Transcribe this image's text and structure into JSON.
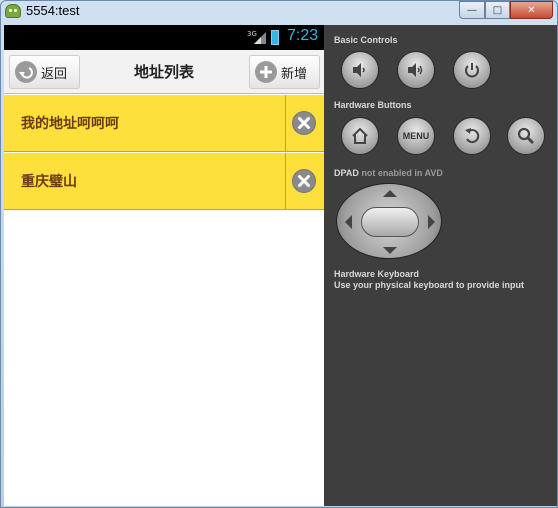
{
  "window": {
    "title": "5554:test",
    "buttons": {
      "minimize": "—",
      "maximize": "□",
      "close": "✕"
    }
  },
  "statusbar": {
    "network": "3G",
    "time": "7:23",
    "accent_color": "#33b5e5"
  },
  "header": {
    "back_label": "返回",
    "title": "地址列表",
    "add_label": "新增"
  },
  "addresses": [
    {
      "label": "我的地址呵呵呵"
    },
    {
      "label": "重庆璧山"
    }
  ],
  "list_color": "#fee03c",
  "controls": {
    "basic_controls_label": "Basic Controls",
    "hardware_buttons_label": "Hardware Buttons",
    "menu_label": "MENU",
    "dpad_label": "DPAD",
    "dpad_status": "not enabled in AVD",
    "keyboard_title": "Hardware Keyboard",
    "keyboard_hint": "Use your physical keyboard to provide input"
  }
}
